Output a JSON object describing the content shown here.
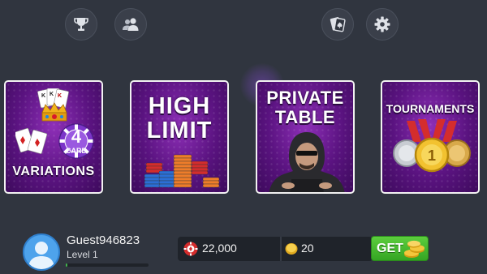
{
  "top_bar": {
    "buttons": [
      {
        "icon": "trophy-icon"
      },
      {
        "icon": "friends-icon"
      },
      {
        "icon": "cards-icon"
      },
      {
        "icon": "gear-icon"
      }
    ]
  },
  "modes": [
    {
      "title_line1": "VARIATIONS",
      "badge_number": "4",
      "badge_label": "CARD"
    },
    {
      "title_line1": "HIGH",
      "title_line2": "LIMIT"
    },
    {
      "title_line1": "PRIVATE",
      "title_line2": "TABLE"
    },
    {
      "title_line1": "TOURNAMENTS"
    }
  ],
  "player": {
    "name": "Guest946823",
    "level": "Level 1",
    "xp_fraction": 0.02
  },
  "wallet": {
    "chips": "22,000",
    "coins": "20",
    "get_label": "GET"
  },
  "colors": {
    "background": "#30353f",
    "card_purple": "#5a1380",
    "get_green": "#3cb02a"
  }
}
